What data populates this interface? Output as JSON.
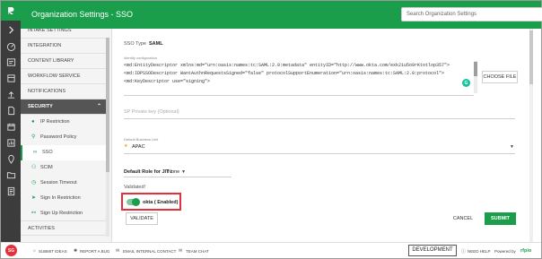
{
  "header": {
    "title": "Organization Settings - SSO",
    "search_placeholder": "Search Organization Settings"
  },
  "sidebar": {
    "items": [
      {
        "label": "INTAKE SETTINGS"
      },
      {
        "label": "INTEGRATION"
      },
      {
        "label": "CONTENT LIBRARY"
      },
      {
        "label": "WORKFLOW SERVICE"
      },
      {
        "label": "NOTIFICATIONS"
      }
    ],
    "section": {
      "label": "SECURITY",
      "expanded": true
    },
    "sub_items": [
      {
        "label": "IP Restriction",
        "icon": "ip-restriction-icon"
      },
      {
        "label": "Password Policy",
        "icon": "key-icon"
      },
      {
        "label": "SSO",
        "icon": "link-icon",
        "active": true
      },
      {
        "label": "SCIM",
        "icon": "users-icon"
      },
      {
        "label": "Session Timeout",
        "icon": "clock-icon"
      },
      {
        "label": "Sign In Restriction",
        "icon": "sign-in-icon"
      },
      {
        "label": "Sign Up Restriction",
        "icon": "user-plus-icon"
      }
    ],
    "bottom_item": {
      "label": "ACTIVITIES"
    }
  },
  "main": {
    "sso_type_label": "SSO Type",
    "sso_type_value": "SAML",
    "identity_config_label": "Identity configuration",
    "identity_config_lines": [
      "<md:EntityDescriptor xmlns:md=\"urn:oasis:names:tc:SAML:2.0:metadata\" entityID=\"http://www.okta.com/exk21u5o9rKtotlop357\">",
      "<md:IDPSSODescriptor WantAuthnRequestsSigned=\"false\" protocolSupportEnumeration=\"urn:oasis:names:tc:SAML:2.0:protocol\">",
      "<md:KeyDescriptor use=\"signing\">"
    ],
    "choose_file": "CHOOSE FILE",
    "private_key_placeholder": "SP Private key (Optional)",
    "default_bu_label": "Default Business Unit",
    "default_bu_value": "APAC",
    "default_role_label": "Default Role for JIT :",
    "default_role_value": "None",
    "validated_text": "Validated!",
    "toggle_label": "okta ( Enabled)",
    "toggle_on": true,
    "validate_button": "VALIDATE",
    "cancel_button": "CANCEL",
    "submit_button": "SUBMIT"
  },
  "footer": {
    "avatar_initials": "SG",
    "links": [
      "SUBMIT IDEAS",
      "REPORT A BUG",
      "EMAIL INTERNAL CONTACT",
      "TEAM CHAT"
    ],
    "environment_badge": "DEVELOPMENT",
    "need_help": "NEED HELP",
    "powered_by": "Powered by",
    "brand": "rfpio"
  },
  "colors": {
    "accent": "#1b9e4b",
    "rail": "#3c3c3c",
    "highlight_box": "#e5303c"
  }
}
